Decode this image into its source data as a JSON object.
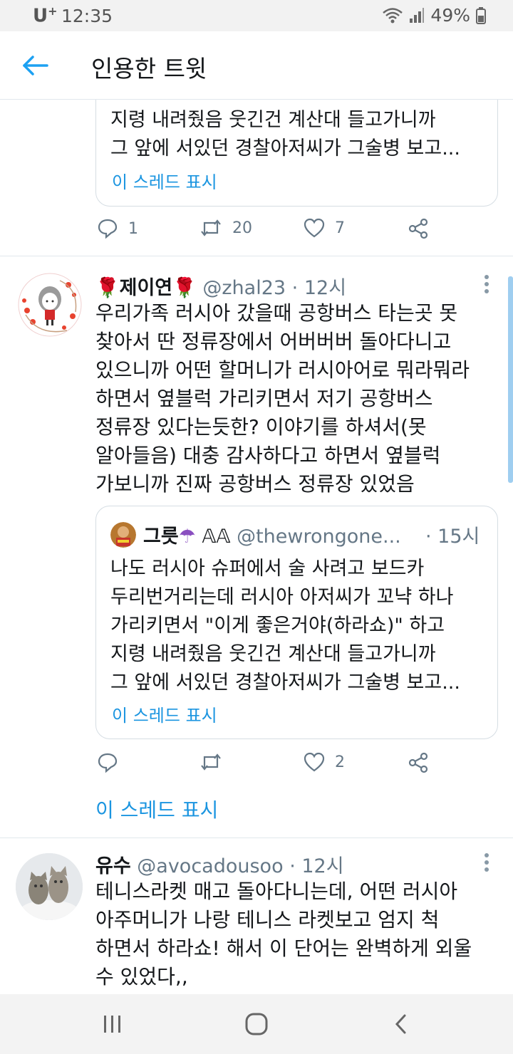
{
  "status_bar": {
    "carrier": "U",
    "carrier_plus": "+",
    "time": "12:35",
    "battery": "49%"
  },
  "header": {
    "title": "인용한 트윗"
  },
  "top_partial": {
    "quote_lines": "지령 내려줬음 웃긴건 계산대 들고가니까\n그 앞에 서있던 경찰아저씨가 그술병 보고...",
    "show_thread": "이 스레드 표시",
    "replies": "1",
    "retweets": "20",
    "likes": "7"
  },
  "tweets": [
    {
      "name": "제이연",
      "handle": "@zhal23",
      "time": "· 12시",
      "text": "우리가족 러시아 갔을때 공항버스 타는곳 못\n찾아서 딴 정류장에서 어버버버 돌아다니고\n있으니까 어떤 할머니가 러시아어로 뭐라뭐라\n하면서 옆블럭 가리키면서 저기 공항버스\n정류장 있다는듯한? 이야기를 하셔서(못\n알아들음) 대충 감사하다고 하면서 옆블럭\n가보니까 진짜 공항버스 정류장 있었음",
      "quote": {
        "name": "그릇",
        "name_suffix": "𝔸𝔸",
        "handle": "@thewrongone...",
        "time": "· 15시",
        "text": "나도 러시아 슈퍼에서 술 사려고 보드카\n두리번거리는데 러시아 아저씨가 꼬냑 하나\n가리키면서 \"이게 좋은거야(하라쇼)\" 하고\n지령 내려줬음 웃긴건 계산대 들고가니까\n그 앞에 서있던 경찰아저씨가 그술병 보고...",
        "show_thread": "이 스레드 표시"
      },
      "likes": "2",
      "show_thread": "이 스레드 표시"
    },
    {
      "name": "유수",
      "handle": "@avocadousoo",
      "time": "· 12시",
      "text": "테니스라켓 매고 돌아다니는데, 어떤 러시아\n아주머니가 나랑 테니스 라켓보고 엄지 척\n하면서 하라쇼! 해서 이 단어는 완벽하게 외울\n수 있었다,,"
    }
  ],
  "colors": {
    "accent": "#1da1f2",
    "link": "#1b95e0",
    "muted": "#657786",
    "text": "#14171a"
  }
}
